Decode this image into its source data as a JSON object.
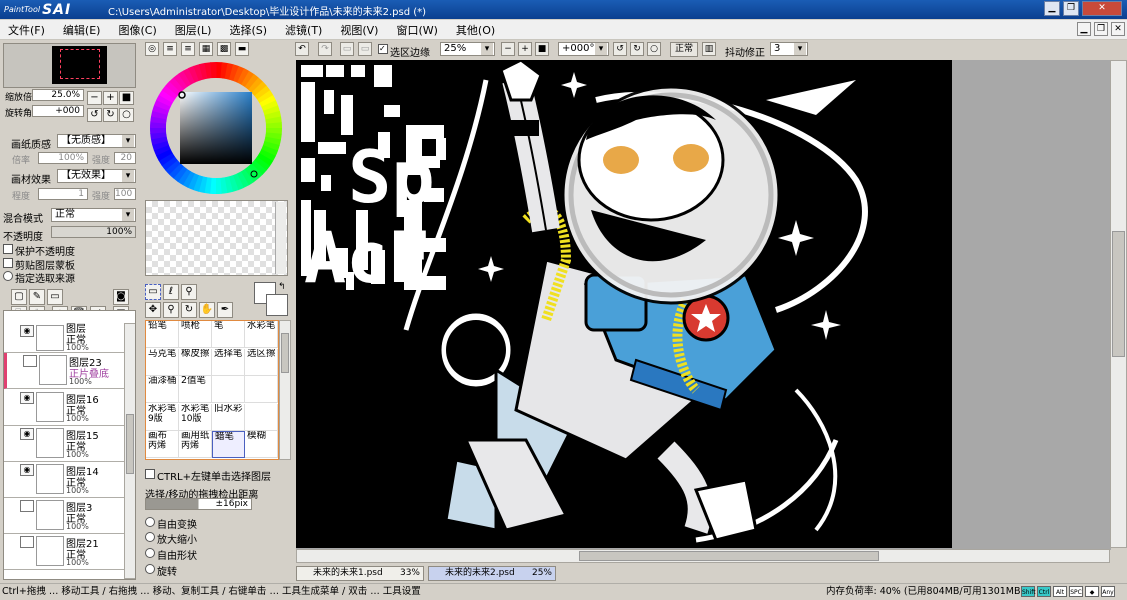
{
  "app": {
    "logo_small": "PaintTool",
    "logo_big": "SAI",
    "title": "C:\\Users\\Administrator\\Desktop\\毕业设计作品\\未来的未来2.psd (*)"
  },
  "window_buttons": [
    "▁",
    "❐",
    "✕"
  ],
  "mdi_buttons": [
    "▁",
    "❐",
    "✕"
  ],
  "menu": [
    "文件(F)",
    "编辑(E)",
    "图像(C)",
    "图层(L)",
    "选择(S)",
    "滤镜(T)",
    "视图(V)",
    "窗口(W)",
    "其他(O)"
  ],
  "navigator": {
    "zoom_label": "缩放倍率",
    "zoom_value": "25.0%",
    "rotate_label": "旋转角度",
    "rotate_value": "+000"
  },
  "paper": {
    "texture_label": "画纸质感",
    "texture_value": "【无质感】",
    "scale_label": "倍率",
    "scale_value": "100%",
    "strength_label": "强度",
    "strength_value": "20",
    "effect_label": "画材效果",
    "effect_value": "【无效果】",
    "width_label": "程度",
    "width_value": "1",
    "strength2_label": "强度",
    "strength2_value": "100"
  },
  "layer_props": {
    "blend_label": "混合模式",
    "blend_value": "正常",
    "opacity_label": "不透明度",
    "opacity_value": "100%",
    "opacity_fraction": 1.0,
    "opt1": "保护不透明度",
    "opt2": "剪贴图层蒙板",
    "opt3": "指定选取来源"
  },
  "layers": [
    {
      "name": "图层",
      "mode": "正常",
      "opacity": "100%",
      "visible": true,
      "selected": false
    },
    {
      "name": "图层23",
      "mode": "正片叠底",
      "opacity": "100%",
      "visible": false,
      "selected": true
    },
    {
      "name": "图层16",
      "mode": "正常",
      "opacity": "100%",
      "visible": true,
      "selected": false
    },
    {
      "name": "图层15",
      "mode": "正常",
      "opacity": "100%",
      "visible": true,
      "selected": false
    },
    {
      "name": "图层14",
      "mode": "正常",
      "opacity": "100%",
      "visible": true,
      "selected": false
    },
    {
      "name": "图层3",
      "mode": "正常",
      "opacity": "100%",
      "visible": false,
      "selected": false
    },
    {
      "name": "图层21",
      "mode": "正常",
      "opacity": "100%",
      "visible": false,
      "selected": false
    }
  ],
  "tools": [
    {
      "l1": "铅笔",
      "l2": ""
    },
    {
      "l1": "喷枪",
      "l2": ""
    },
    {
      "l1": "笔",
      "l2": ""
    },
    {
      "l1": "水彩笔",
      "l2": ""
    },
    {
      "l1": "马克笔",
      "l2": ""
    },
    {
      "l1": "橡皮擦",
      "l2": ""
    },
    {
      "l1": "选择笔",
      "l2": ""
    },
    {
      "l1": "选区擦",
      "l2": ""
    },
    {
      "l1": "油漆桶",
      "l2": ""
    },
    {
      "l1": "2值笔",
      "l2": ""
    },
    {
      "l1": "",
      "l2": ""
    },
    {
      "l1": "",
      "l2": ""
    },
    {
      "l1": "水彩笔",
      "l2": "9版"
    },
    {
      "l1": "水彩笔",
      "l2": "10版"
    },
    {
      "l1": "旧水彩",
      "l2": ""
    },
    {
      "l1": "",
      "l2": ""
    },
    {
      "l1": "画布",
      "l2": "丙烯"
    },
    {
      "l1": "画用纸",
      "l2": "丙烯"
    },
    {
      "l1": "蜡笔",
      "l2": ""
    },
    {
      "l1": "模糊",
      "l2": ""
    }
  ],
  "select_opts": {
    "ctrl_label": "CTRL+左键单击选择图层",
    "dist_label": "选择/移动的拖拽检出距离",
    "dist_value": "±16pix",
    "r1": "自由变换",
    "r2": "放大缩小",
    "r3": "自由形状",
    "r4": "旋转"
  },
  "canvas_toolbar": {
    "sel_edge": "选区边缘",
    "zoom": "25%",
    "angle": "+000°",
    "mode": "正常",
    "stab_label": "抖动修正",
    "stab_value": "3"
  },
  "artwork_letters": [
    "Sp",
    "AcE"
  ],
  "tabs": [
    {
      "name": "未来的未来1.psd",
      "zoom": "33%",
      "active": false
    },
    {
      "name": "未来的未来2.psd",
      "zoom": "25%",
      "active": true
    }
  ],
  "status": {
    "hint": "Ctrl+拖拽 … 移动工具 / 右拖拽 … 移动、复制工具 / 右键单击 … 工具生成菜单 / 双击 … 工具设置",
    "memory": "内存负荷率: 40% (已用804MB/可用1301MB)",
    "keys": [
      "Shift",
      "Ctrl",
      "Alt",
      "SPC",
      "◆",
      "Any"
    ]
  },
  "colors": {
    "title_bar": "#1a5db5",
    "panel": "#d4d0c8",
    "selected_layer": "#e04070",
    "tool_border": "#e08a40",
    "astronaut_blue": "#4aa0d8",
    "cheek_orange": "#e8a848",
    "hose_yellow": "#f0e020",
    "badge_red": "#d83a30"
  }
}
